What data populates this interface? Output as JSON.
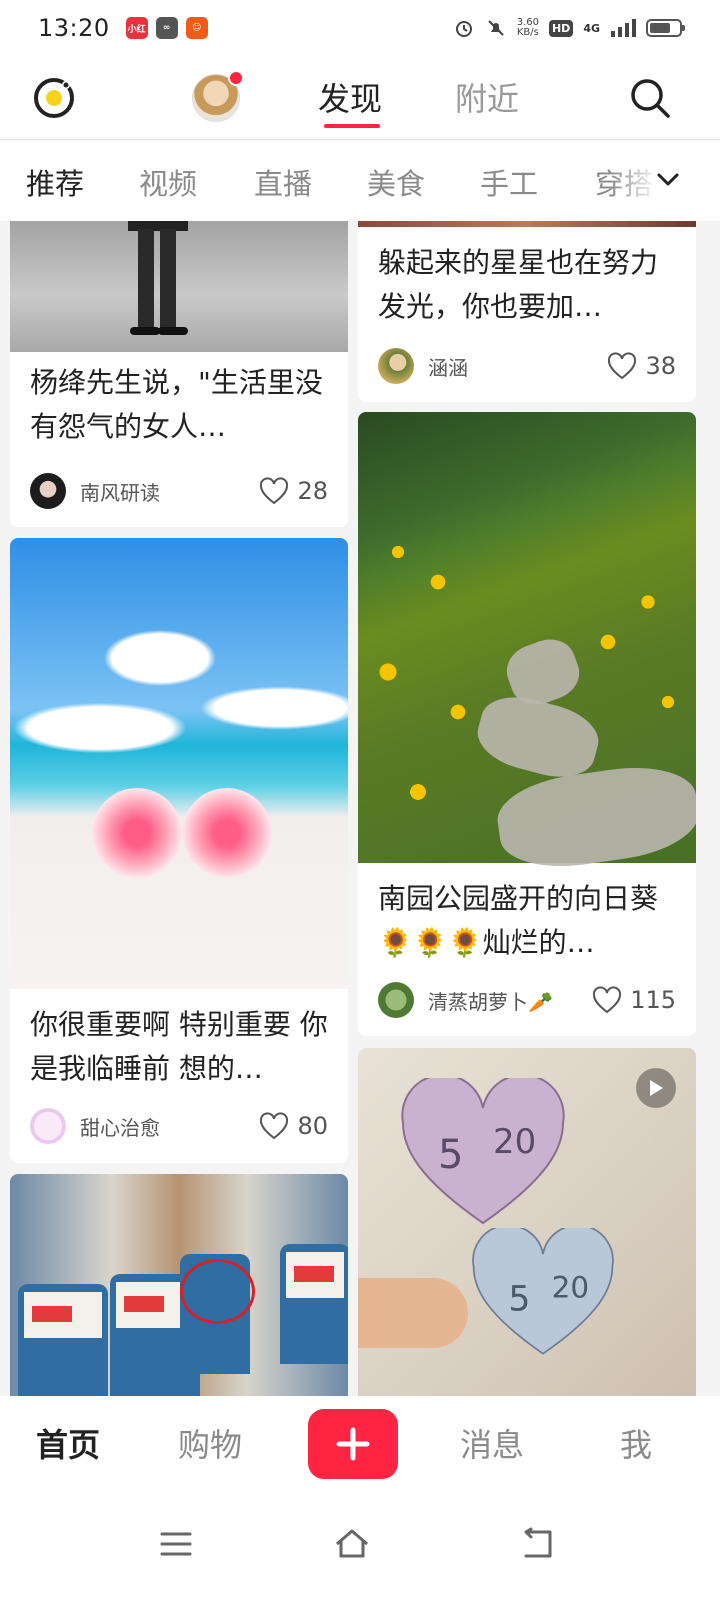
{
  "status_bar": {
    "time": "13:20",
    "apps": [
      {
        "name": "app-icon-1",
        "color": "#e9323c",
        "text": "小红书"
      },
      {
        "name": "app-icon-2",
        "color": "#555555",
        "text": ""
      },
      {
        "name": "app-icon-3",
        "color": "#f25a1a",
        "text": ""
      }
    ],
    "net_speed": "3.60",
    "net_unit": "KB/s",
    "hd": "HD",
    "signal": "4G"
  },
  "top_nav": {
    "tabs": [
      "发现",
      "附近"
    ],
    "active_tab": "发现",
    "accent": "#ff2442"
  },
  "categories": {
    "items": [
      "推荐",
      "视频",
      "直播",
      "美食",
      "手工",
      "穿搭"
    ],
    "active": "推荐"
  },
  "feed": {
    "left": [
      {
        "title": "杨绛先生说，\"生活里没有怨气的女人…",
        "author": "南风研读",
        "likes": "28",
        "image": "street photo"
      },
      {
        "title": "你很重要啊 特别重要 你是我临睡前 想的…",
        "author": "甜心治愈",
        "likes": "80",
        "image": "beach hearts"
      },
      {
        "title": "",
        "author": "",
        "likes": "",
        "image": "train seats"
      }
    ],
    "right": [
      {
        "title": "躲起来的星星也在努力发光，你也要加…",
        "author": "涵涵",
        "likes": "38",
        "image": "stars"
      },
      {
        "title": "南园公园盛开的向日葵🌻🌻🌻灿烂的…",
        "author": "清蒸胡萝卜🥕",
        "likes": "115",
        "image": "sunflower field"
      },
      {
        "title": "",
        "author": "",
        "likes": "",
        "image": "money hearts",
        "has_video": true
      }
    ]
  },
  "bottom_bar": {
    "home": "首页",
    "shop": "购物",
    "add": "+",
    "messages": "消息",
    "me": "我",
    "active": "首页"
  }
}
